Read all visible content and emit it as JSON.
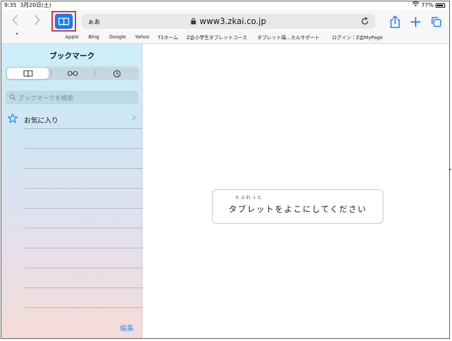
{
  "status": {
    "time": "9:35",
    "date": "3月20日(土)",
    "battery": "77%"
  },
  "toolbar": {
    "text_size": "ぁあ",
    "url": "www3.zkai.co.jp"
  },
  "favorites": [
    "Apple",
    "Bing",
    "Google",
    "Yahoo",
    "T1ホーム",
    "Z会小学生タブレットコース",
    "タブレット端…カルサポート",
    "ログイン｜Z会MyPage"
  ],
  "sidebar": {
    "title": "ブックマーク",
    "search_placeholder": "ブックマークを検索",
    "favorites_label": "お気に入り",
    "edit_label": "編集"
  },
  "main": {
    "furigana": "たぶれっと",
    "message": "タブレットをよこにしてください"
  },
  "colors": {
    "accent": "#1a7cf5",
    "highlight_box": "#e0322d"
  }
}
